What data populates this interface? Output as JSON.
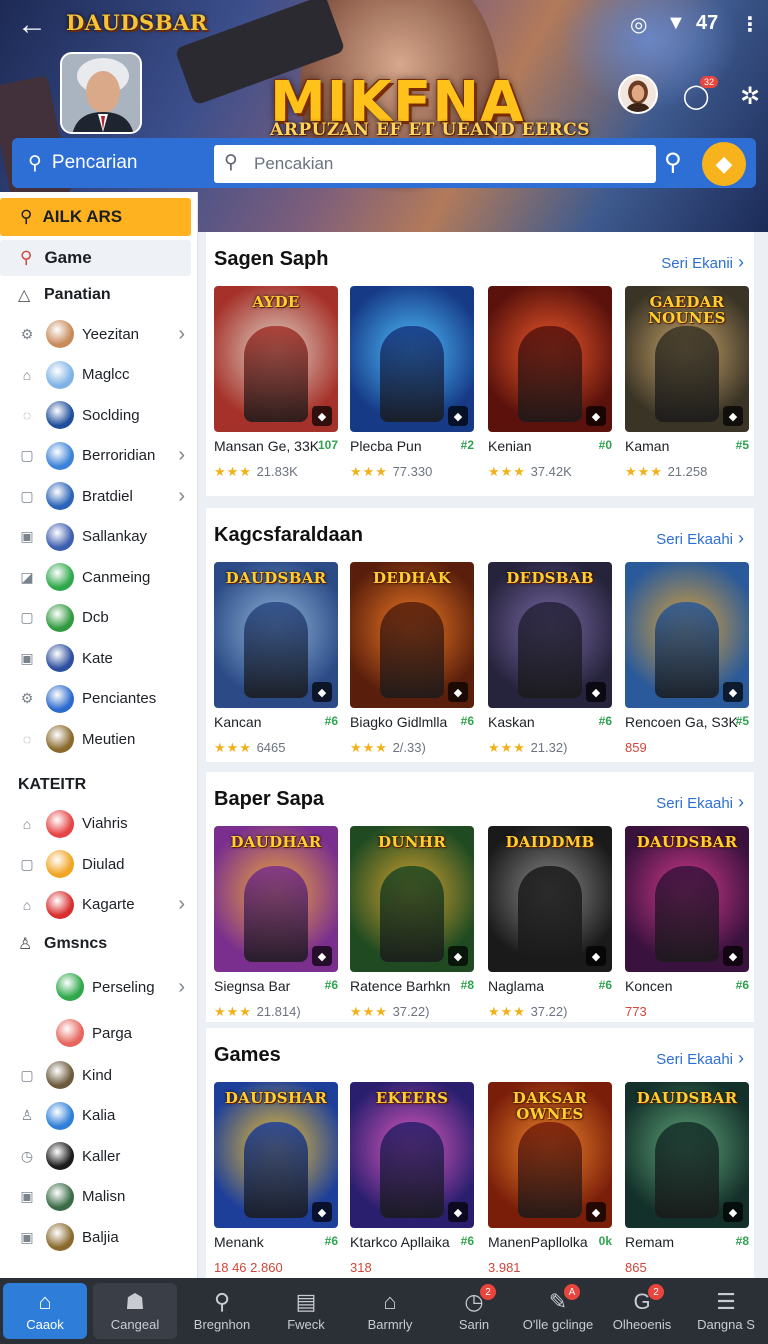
{
  "header": {
    "back_icon": "arrow-left-icon",
    "brand_small": "DAUDSBAR",
    "status_time": "47",
    "hero_title": "MIKFNA",
    "hero_subtitle": "ARPUZAN EF ET UEAND EERCS",
    "notification_count": "32"
  },
  "search": {
    "button_label": "Pencarian",
    "placeholder": "Pencakian"
  },
  "sidebar": {
    "top_label": "AILK ARS",
    "game_label": "Game",
    "subheader": "Panatian",
    "items": [
      {
        "label": "Yeezitan",
        "chev": true,
        "color": "#c98a5a"
      },
      {
        "label": "Maglcc",
        "chev": false,
        "color": "#7fb3e5"
      },
      {
        "label": "Soclding",
        "chev": false,
        "color": "#1f4f9c"
      },
      {
        "label": "Berroridian",
        "chev": true,
        "color": "#3c82d8"
      },
      {
        "label": "Bratdiel",
        "chev": true,
        "color": "#2a63b8"
      },
      {
        "label": "Sallankay",
        "chev": false,
        "color": "#3e5fb0"
      },
      {
        "label": "Canmeing",
        "chev": false,
        "color": "#2ea84a"
      },
      {
        "label": "Dcb",
        "chev": false,
        "color": "#2f9a3e"
      },
      {
        "label": "Kate",
        "chev": false,
        "color": "#2d4fa0"
      },
      {
        "label": "Penciantes",
        "chev": false,
        "color": "#2c6bcd"
      },
      {
        "label": "Meutien",
        "chev": false,
        "color": "#8a6a2c"
      }
    ],
    "section_header": "KATEITR",
    "items2": [
      {
        "label": "Viahris",
        "chev": false,
        "color": "#e64545"
      },
      {
        "label": "Diulad",
        "chev": false,
        "color": "#f0a524"
      },
      {
        "label": "Kagarte",
        "chev": true,
        "color": "#d92e2e"
      }
    ],
    "group_label": "Gmsncs",
    "items3": [
      {
        "label": "Perseling",
        "chev": true,
        "color": "#2ea84a"
      },
      {
        "label": "Parga",
        "chev": false,
        "color": "#e6665e"
      },
      {
        "label": "Kind",
        "chev": false,
        "color": "#6c5a3c"
      },
      {
        "label": "Kalia",
        "chev": false,
        "color": "#2f7fd8"
      },
      {
        "label": "Kaller",
        "chev": false,
        "color": "#1b1b1b"
      },
      {
        "label": "Malisn",
        "chev": false,
        "color": "#3a6b45"
      },
      {
        "label": "Baljia",
        "chev": false,
        "color": "#8a6a2c"
      }
    ]
  },
  "sections": [
    {
      "title": "Sagen Saph",
      "more": "Seri Ekanii",
      "cards": [
        {
          "name": "Mansan Ge, 33K",
          "tag": "107",
          "rating": "21.83K",
          "art": "AYDE",
          "c1": "#a5322a",
          "c2": "#e2d5c9"
        },
        {
          "name": "Plecba Pun",
          "tag": "#2",
          "rating": "77.330",
          "art": "",
          "c1": "#163a86",
          "c2": "#4fc0ff"
        },
        {
          "name": "Kenian",
          "tag": "#0",
          "rating": "37.42K",
          "art": "",
          "c1": "#5b120c",
          "c2": "#f05a2b"
        },
        {
          "name": "Kaman",
          "tag": "#5",
          "rating": "21.258",
          "art": "GAEDAR NOUNES",
          "c1": "#3a3426",
          "c2": "#c9a56a"
        }
      ]
    },
    {
      "title": "Kagcsfaraldaan",
      "more": "Seri Ekaahi",
      "cards": [
        {
          "name": "Kancan",
          "tag": "#6",
          "rating": "6465",
          "art": "DAUDSBAR",
          "c1": "#2b4a86",
          "c2": "#8fb5d9"
        },
        {
          "name": "Biagko Gidlmlla",
          "tag": "#6",
          "rating": "2/.33)",
          "art": "DEDHAK",
          "c1": "#5a1f0c",
          "c2": "#f07a24"
        },
        {
          "name": "Kaskan",
          "tag": "#6",
          "rating": "21.32)",
          "art": "DEDSBAB",
          "c1": "#26233c",
          "c2": "#7a6aa6"
        },
        {
          "name": "Rencoen Ga, S3K",
          "tag": "#5",
          "rating": "859",
          "art": "",
          "c1": "#2a5a9a",
          "c2": "#d9a13a"
        }
      ]
    },
    {
      "title": "Baper Sapa",
      "more": "Seri Ekaahi",
      "cards": [
        {
          "name": "Siegnsa Bar",
          "tag": "#6",
          "rating": "21.814)",
          "art": "DAUDHAR",
          "c1": "#7a2f8e",
          "c2": "#f0a83a"
        },
        {
          "name": "Ratence Barhkn",
          "tag": "#8",
          "rating": "37.22)",
          "art": "DUNHR",
          "c1": "#1f4a22",
          "c2": "#d6a330"
        },
        {
          "name": "Naglama",
          "tag": "#6",
          "rating": "37.22)",
          "art": "DAIDDMB",
          "c1": "#1a1a1a",
          "c2": "#8a8a8a"
        },
        {
          "name": "Koncen",
          "tag": "#6",
          "rating": "773",
          "art": "DAUDSBAR",
          "c1": "#3a123e",
          "c2": "#d23a8a"
        }
      ]
    },
    {
      "title": "Games",
      "more": "Seri Ekaahi",
      "cards": [
        {
          "name": "Menank",
          "tag": "#6",
          "rating": "18 46  2.860",
          "art": "DAUDSHAR",
          "c1": "#1d3f9a",
          "c2": "#f2c230"
        },
        {
          "name": "Ktarkco Apllaika",
          "tag": "#6",
          "rating": "318",
          "art": "EKEERS",
          "c1": "#2a1f6e",
          "c2": "#e05ac0"
        },
        {
          "name": "ManenPapllolka",
          "tag": "0k",
          "rating": "3.981",
          "art": "DAKSAR OWNES",
          "c1": "#7a1e0a",
          "c2": "#f0872a"
        },
        {
          "name": "Remam",
          "tag": "#8",
          "rating": "865",
          "art": "DAUDSBAR",
          "c1": "#14302a",
          "c2": "#5fa67a"
        }
      ]
    }
  ],
  "tabs": [
    {
      "label": "Caaok",
      "icon": "home-icon",
      "glyph": "⌂"
    },
    {
      "label": "Cangeal",
      "icon": "cat-icon",
      "glyph": "☗"
    },
    {
      "label": "Bregnhon",
      "icon": "search-icon",
      "glyph": "⚲"
    },
    {
      "label": "Fweck",
      "icon": "list-icon",
      "glyph": "▤"
    },
    {
      "label": "Barmrly",
      "icon": "store-icon",
      "glyph": "⌂"
    },
    {
      "label": "Sarin",
      "icon": "clock-icon",
      "glyph": "◷",
      "badge": "2"
    },
    {
      "label": "O'lle gclinge",
      "icon": "edit-icon",
      "glyph": "✎",
      "badge": "A"
    },
    {
      "label": "Olheoenis",
      "icon": "g-icon",
      "glyph": "G",
      "badge": "2"
    },
    {
      "label": "Dangna S",
      "icon": "menu-icon",
      "glyph": "☰"
    }
  ]
}
